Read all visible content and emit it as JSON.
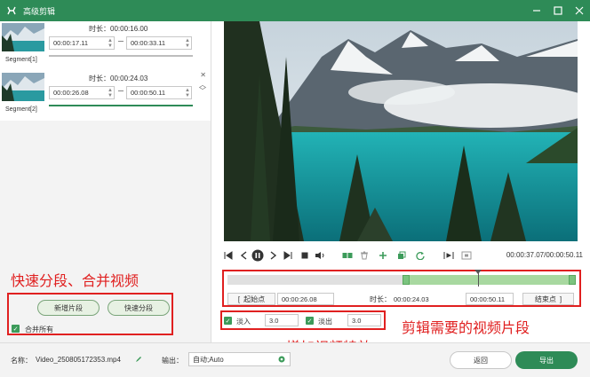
{
  "window": {
    "title": "高级剪辑"
  },
  "segments": [
    {
      "label": "Segment[1]",
      "duration_label": "时长：",
      "duration": "00:00:16.00",
      "start": "00:00:17.11",
      "end": "00:00:33.11"
    },
    {
      "label": "Segment[2]",
      "duration_label": "时长：",
      "duration": "00:00:24.03",
      "start": "00:00:26.08",
      "end": "00:00:50.11"
    }
  ],
  "annotations": {
    "left": "快速分段、合并视频",
    "right": "剪辑需要的视频片段",
    "bottom": "增加视频特效"
  },
  "left_actions": {
    "add_segment": "新增片段",
    "quick_split": "快速分段",
    "merge_all": "合并所有"
  },
  "player": {
    "timecode": "00:00:37.07/00:00:50.11"
  },
  "trim": {
    "start_button": "起始点",
    "start_time": "00:00:26.08",
    "duration_label": "时长：",
    "duration": "00:00:24.03",
    "end_time": "00:00:50.11",
    "end_button": "结束点"
  },
  "effects": {
    "fade_in_label": "淡入",
    "fade_in": "3.0",
    "fade_out_label": "淡出",
    "fade_out": "3.0"
  },
  "bottom": {
    "name_label": "名称：",
    "file_name": "Video_250805172353.mp4",
    "output_label": "输出：",
    "output_value": "自动;Auto",
    "back_label": "返回",
    "export_label": "导出"
  },
  "colors": {
    "brand": "#2e8b57",
    "accent_red": "#e02020"
  }
}
